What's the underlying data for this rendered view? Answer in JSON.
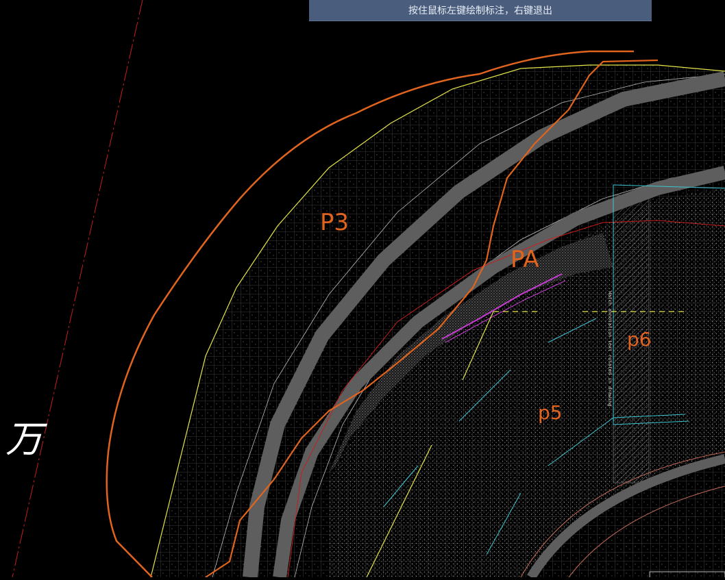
{
  "hint": {
    "text": "按住鼠标左键绘制标注，右键退出"
  },
  "drawing": {
    "region_labels": {
      "p3": "P3",
      "pa": "PA",
      "p5": "p5",
      "p6": "p6"
    },
    "char_label": "万",
    "vertical_note": "Hatch annotation text rotated in drawing",
    "colors": {
      "background": "#000000",
      "contour_orange": "#e0641e",
      "road_gray": "#5a5a5a",
      "boundary_yellow": "#e6e64a",
      "cyan": "#3cc8d2",
      "magenta": "#c83cd2",
      "red_axis": "#c81e1e",
      "grid": "#5a5a5a"
    }
  }
}
